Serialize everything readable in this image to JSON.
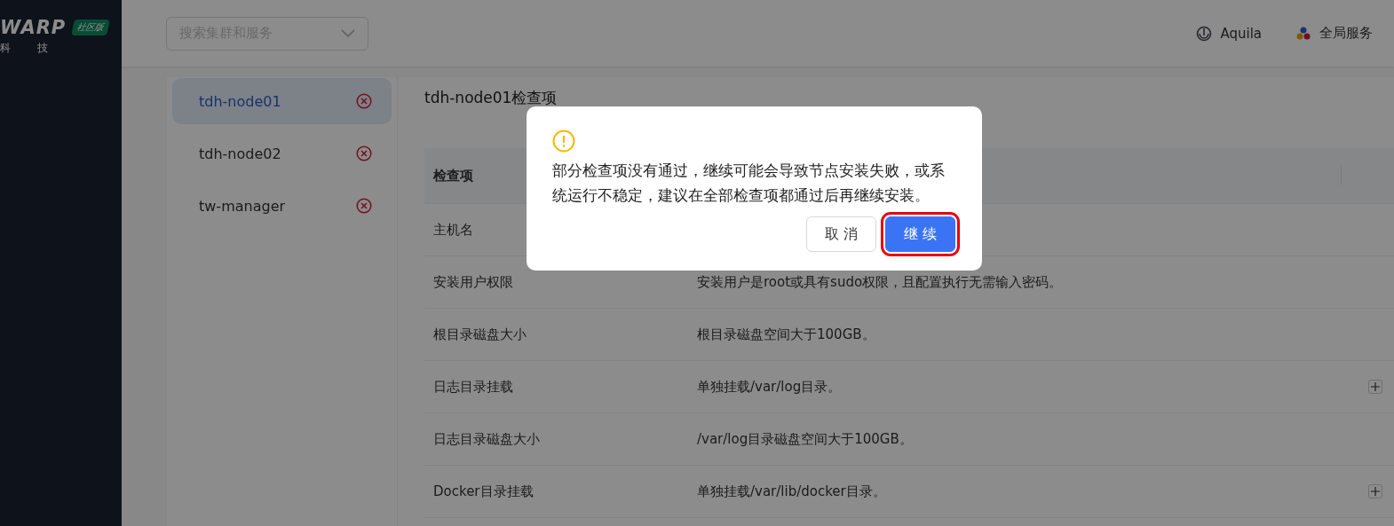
{
  "brand": {
    "logo": "WARP",
    "badge": "社区版",
    "tagline": [
      "科",
      "技"
    ]
  },
  "header": {
    "search": {
      "placeholder": "搜索集群和服务"
    },
    "user": "Aquila",
    "services": "全局服务"
  },
  "nodes": [
    {
      "name": "tdh-node01",
      "selected": true,
      "failed": true
    },
    {
      "name": "tdh-node02",
      "selected": false,
      "failed": true
    },
    {
      "name": "tw-manager",
      "selected": false,
      "failed": true
    }
  ],
  "panel": {
    "title": "tdh-node01检查项",
    "table": {
      "columns": [
        "检查项"
      ],
      "rows": [
        {
          "item": "主机名",
          "expandable": false
        },
        {
          "item": "安装用户权限",
          "requirement": "安装用户是root或具有sudo权限，且配置执行无需输入密码。",
          "expandable": false
        },
        {
          "item": "根目录磁盘大小",
          "requirement": "根目录磁盘空间大于100GB。",
          "expandable": false
        },
        {
          "item": "日志目录挂载",
          "requirement": "单独挂载/var/log目录。",
          "expandable": true
        },
        {
          "item": "日志目录磁盘大小",
          "requirement": "/var/log目录磁盘空间大于100GB。",
          "expandable": false
        },
        {
          "item": "Docker目录挂载",
          "requirement": "单独挂载/var/lib/docker目录。",
          "expandable": true
        }
      ]
    }
  },
  "dialog": {
    "message": "部分检查项没有通过，继续可能会导致节点安装失败，或系统运行不稳定，建议在全部检查项都通过后再继续安装。",
    "buttons": [
      {
        "label": "取 消",
        "kind": "default",
        "highlighted": false
      },
      {
        "label": "继 续",
        "kind": "primary",
        "highlighted": true
      }
    ]
  }
}
